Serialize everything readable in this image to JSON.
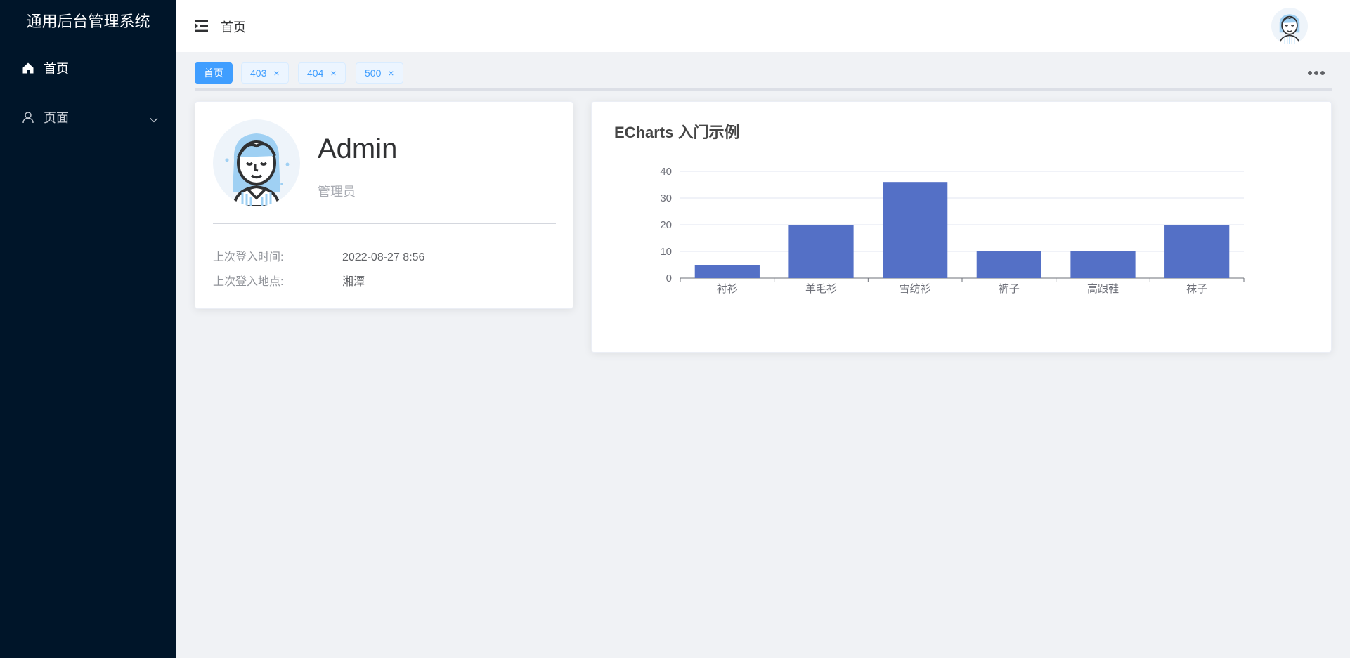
{
  "app": {
    "title": "通用后台管理系统"
  },
  "sidebar": {
    "items": [
      {
        "label": "首页",
        "icon": "home-icon"
      },
      {
        "label": "页面",
        "icon": "user-icon",
        "expandable": true
      }
    ]
  },
  "header": {
    "breadcrumb": "首页"
  },
  "tags": [
    {
      "label": "首页",
      "active": true,
      "closable": false
    },
    {
      "label": "403",
      "active": false,
      "closable": true
    },
    {
      "label": "404",
      "active": false,
      "closable": true
    },
    {
      "label": "500",
      "active": false,
      "closable": true
    }
  ],
  "tag_close_glyph": "×",
  "user_card": {
    "name": "Admin",
    "role": "管理员",
    "last_login_time_label": "上次登入时间:",
    "last_login_time": "2022-08-27 8:56",
    "last_login_place_label": "上次登入地点:",
    "last_login_place": "湘潭"
  },
  "colors": {
    "sidebar_bg": "#001529",
    "accent": "#409eff",
    "bar": "#5470c6"
  },
  "chart_data": {
    "type": "bar",
    "title": "ECharts 入门示例",
    "categories": [
      "衬衫",
      "羊毛衫",
      "雪纺衫",
      "裤子",
      "高跟鞋",
      "袜子"
    ],
    "values": [
      5,
      20,
      36,
      10,
      10,
      20
    ],
    "yticks": [
      "0",
      "10",
      "20",
      "30",
      "40"
    ],
    "ylim": [
      0,
      40
    ],
    "grid": true
  }
}
